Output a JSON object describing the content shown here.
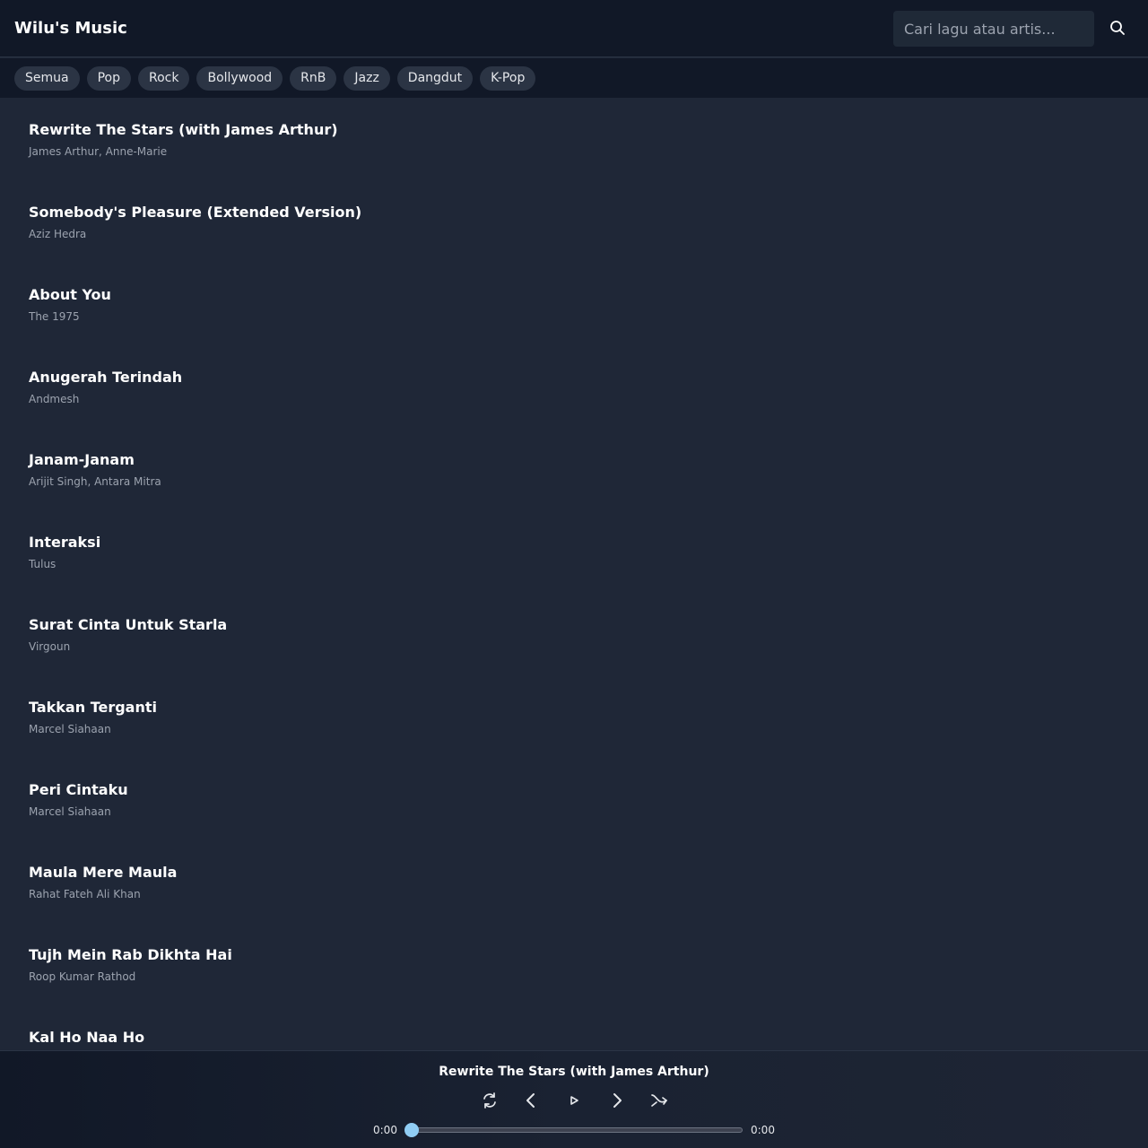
{
  "app": {
    "title": "Wilu's Music"
  },
  "search": {
    "placeholder": "Cari lagu atau artis..."
  },
  "genres": [
    "Semua",
    "Pop",
    "Rock",
    "Bollywood",
    "RnB",
    "Jazz",
    "Dangdut",
    "K-Pop"
  ],
  "songs": [
    {
      "title": "Rewrite The Stars (with James Arthur)",
      "artist": "James Arthur, Anne-Marie"
    },
    {
      "title": "Somebody's Pleasure (Extended Version)",
      "artist": "Aziz Hedra"
    },
    {
      "title": "About You",
      "artist": "The 1975"
    },
    {
      "title": "Anugerah Terindah",
      "artist": "Andmesh"
    },
    {
      "title": "Janam-Janam",
      "artist": "Arijit Singh, Antara Mitra"
    },
    {
      "title": "Interaksi",
      "artist": "Tulus"
    },
    {
      "title": "Surat Cinta Untuk Starla",
      "artist": "Virgoun"
    },
    {
      "title": "Takkan Terganti",
      "artist": "Marcel Siahaan"
    },
    {
      "title": "Peri Cintaku",
      "artist": "Marcel Siahaan"
    },
    {
      "title": "Maula Mere Maula",
      "artist": "Rahat Fateh Ali Khan"
    },
    {
      "title": "Tujh Mein Rab Dikhta Hai",
      "artist": "Roop Kumar Rathod"
    },
    {
      "title": "Kal Ho Naa Ho",
      "artist": ""
    }
  ],
  "player": {
    "now_playing": "Rewrite The Stars (with James Arthur)",
    "current_time": "0:00",
    "duration": "0:00",
    "progress": 0
  },
  "colors": {
    "background": "#1f2737",
    "header": "#111827",
    "accent": "#90cdf4",
    "muted_text": "#9ca3af"
  },
  "icons": {
    "search": "search-icon",
    "repeat": "repeat-icon",
    "previous": "previous-icon",
    "play": "play-icon",
    "next": "next-icon",
    "shuffle": "shuffle-icon"
  }
}
